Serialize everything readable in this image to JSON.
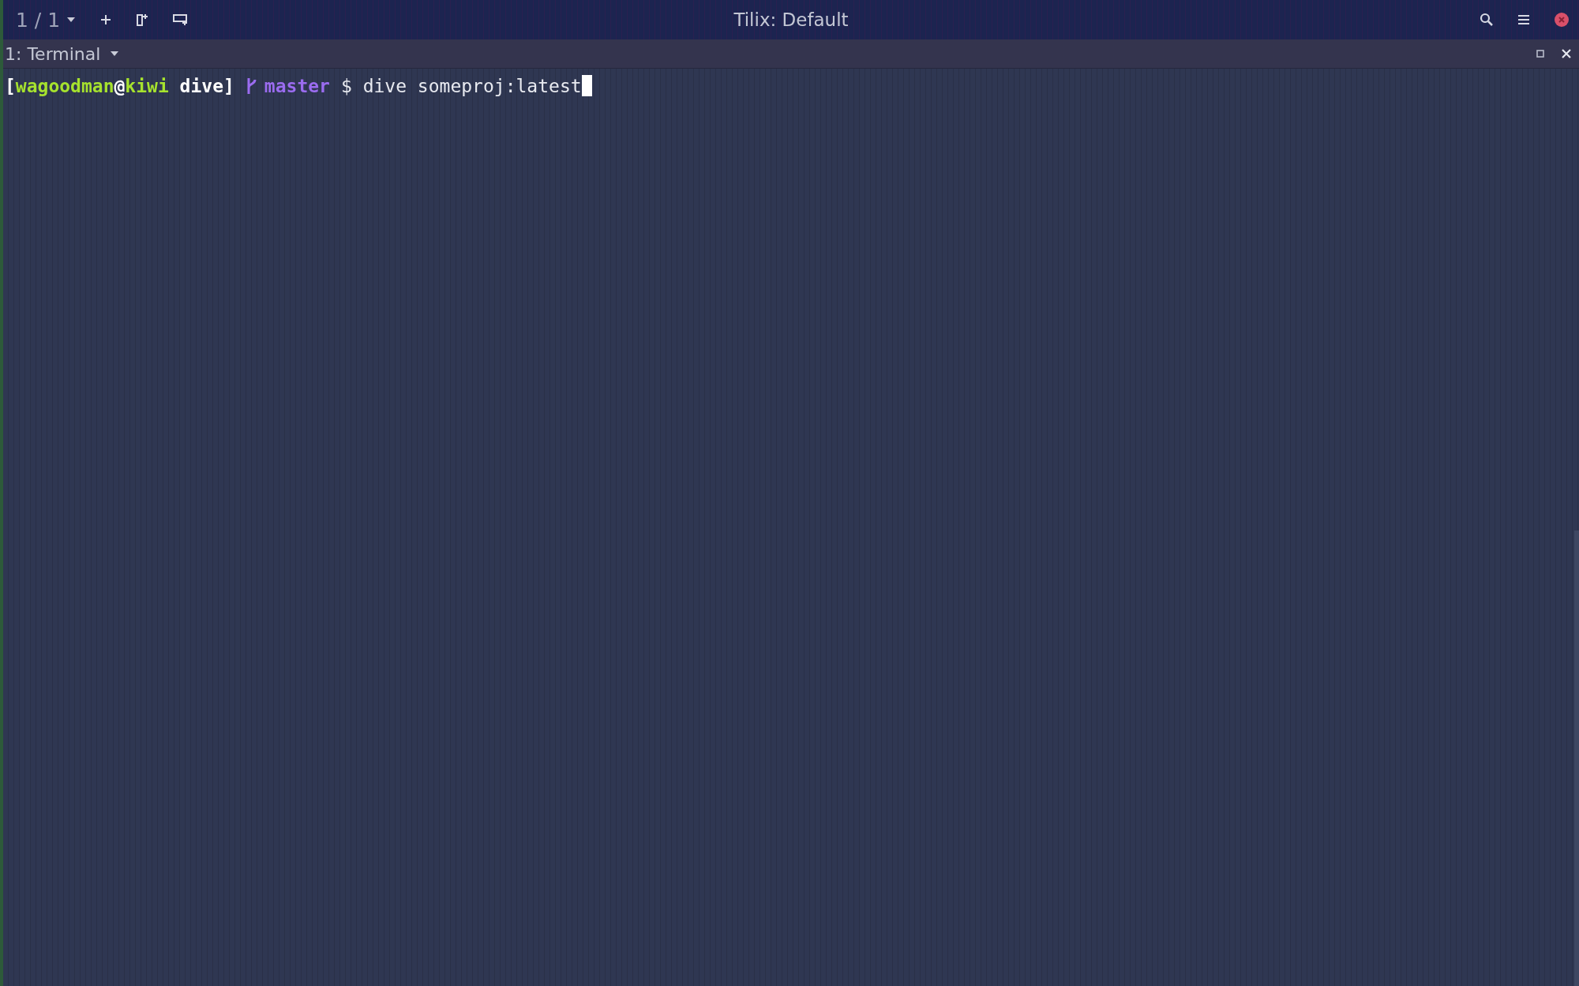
{
  "header": {
    "session_label": "1 / 1",
    "title": "Tilix: Default"
  },
  "terminal_tab": {
    "title": "1: Terminal"
  },
  "prompt": {
    "user": "wagoodman",
    "at": "@",
    "host": "kiwi",
    "dir": "dive]",
    "open": "[",
    "branch": "master",
    "command": "$ dive someproj:latest"
  }
}
